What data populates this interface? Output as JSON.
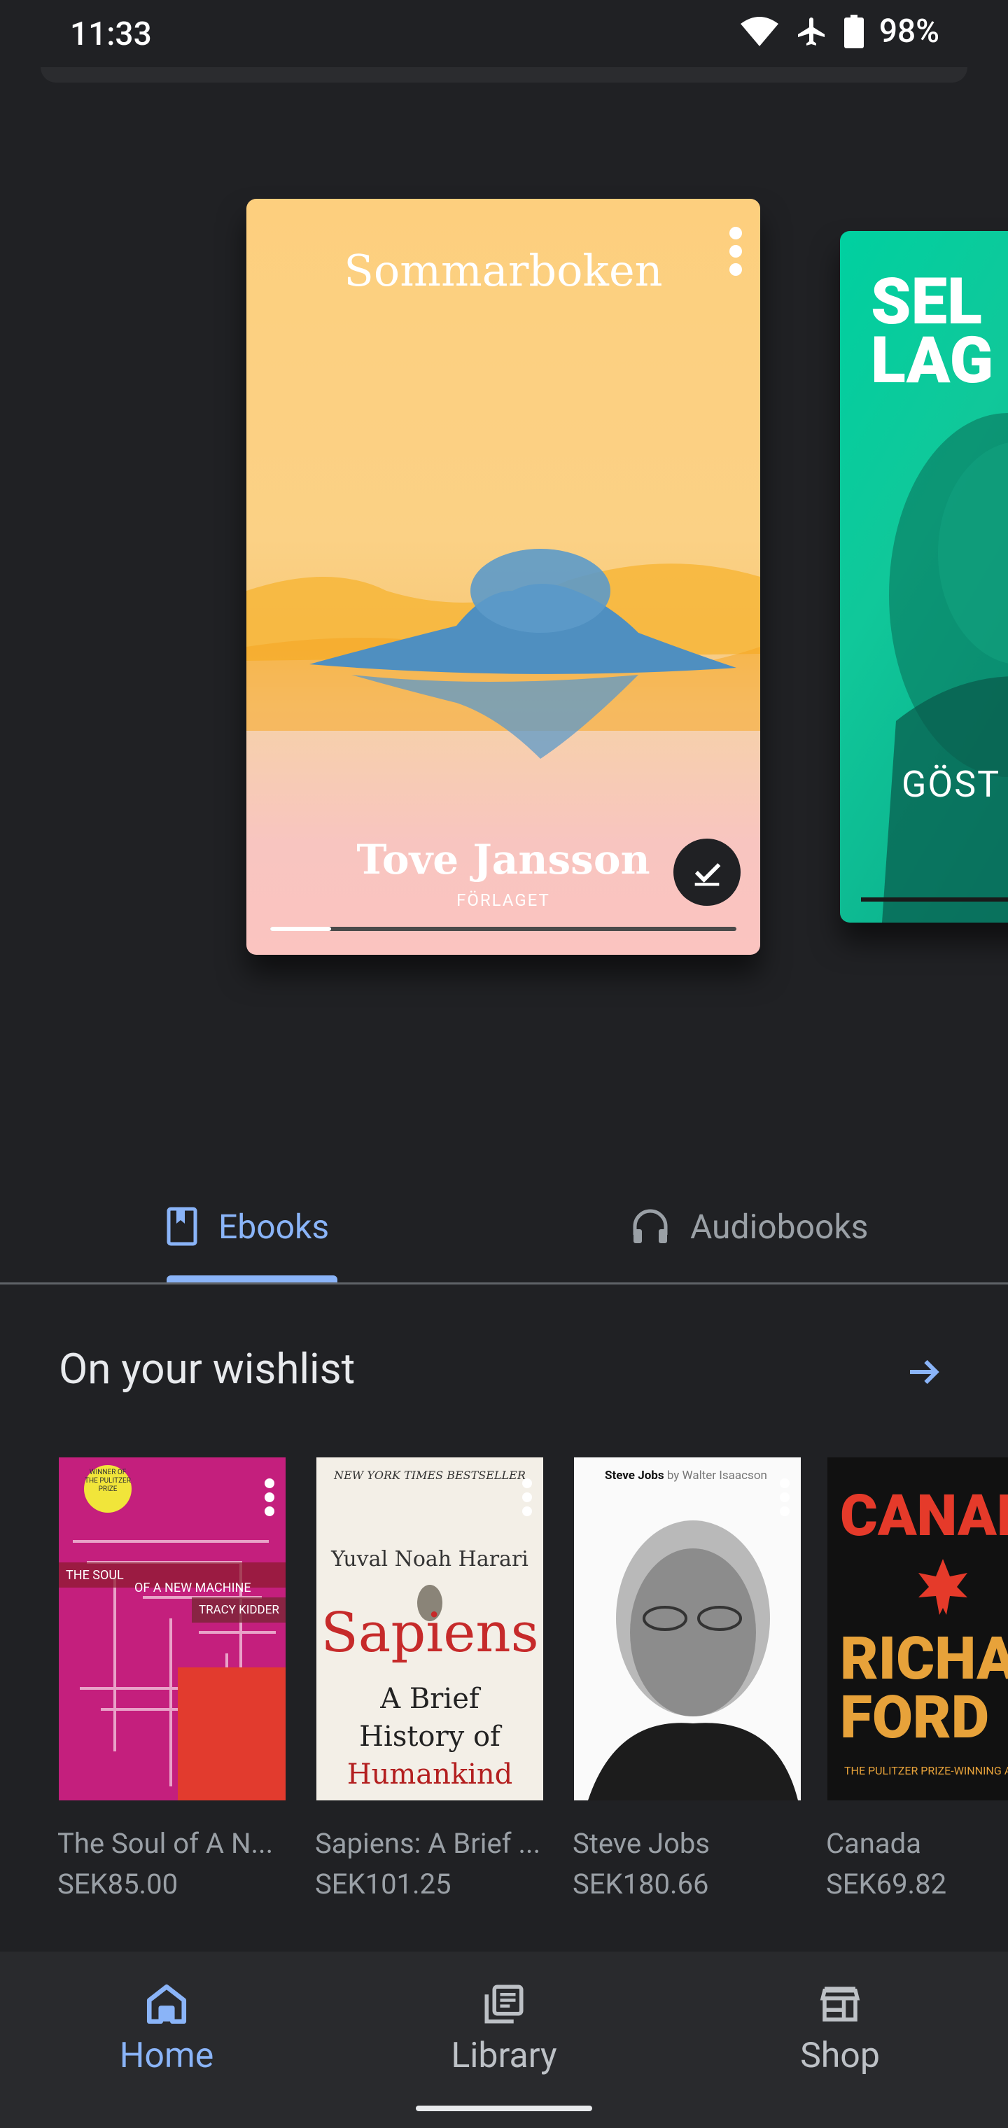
{
  "status_bar": {
    "time": "11:33",
    "battery": "98%"
  },
  "carousel": {
    "main_book": {
      "title": "Sommarboken",
      "author": "Tove Jansson",
      "publisher": "FÖRLAGET",
      "progress": 0.13,
      "downloaded": true
    },
    "second_book": {
      "title_line1": "SEL",
      "title_line2": "LAG",
      "author_fragment": "GÖST"
    }
  },
  "tabs": {
    "ebooks": "Ebooks",
    "audiobooks": "Audiobooks",
    "selected": "ebooks"
  },
  "wishlist": {
    "title": "On your wishlist",
    "items": [
      {
        "name": "The Soul of A N...",
        "price": "SEK85.00"
      },
      {
        "name": "Sapiens: A Brief ...",
        "price": "SEK101.25"
      },
      {
        "name": "Steve Jobs",
        "price": "SEK180.66"
      },
      {
        "name": "Canada",
        "price": "SEK69.82"
      }
    ],
    "covers": {
      "soul": {
        "badge": "WINNER OF THE PULITZER PRIZE",
        "title_part1": "THE SOUL",
        "title_part2": "OF A NEW MACHINE",
        "author": "TRACY KIDDER"
      },
      "sapiens": {
        "banner": "NEW YORK TIMES BESTSELLER",
        "author": "Yuval Noah Harari",
        "title": "Sapiens",
        "subtitle_line1": "A Brief",
        "subtitle_line2": "History of",
        "subtitle_line3": "Humankind"
      },
      "jobs": {
        "title": "Steve Jobs",
        "byline": "by Walter Isaacson"
      },
      "canada": {
        "title": "CANAD",
        "author_line1": "RICHAR",
        "author_line2": "FORD",
        "tagline": "THE PULITZER PRIZE-WINNING AU"
      }
    }
  },
  "bottom_nav": {
    "home": "Home",
    "library": "Library",
    "shop": "Shop",
    "selected": "home"
  },
  "colors": {
    "accent": "#8ab4f8",
    "background": "#202124",
    "nav_background": "#292a2d"
  }
}
